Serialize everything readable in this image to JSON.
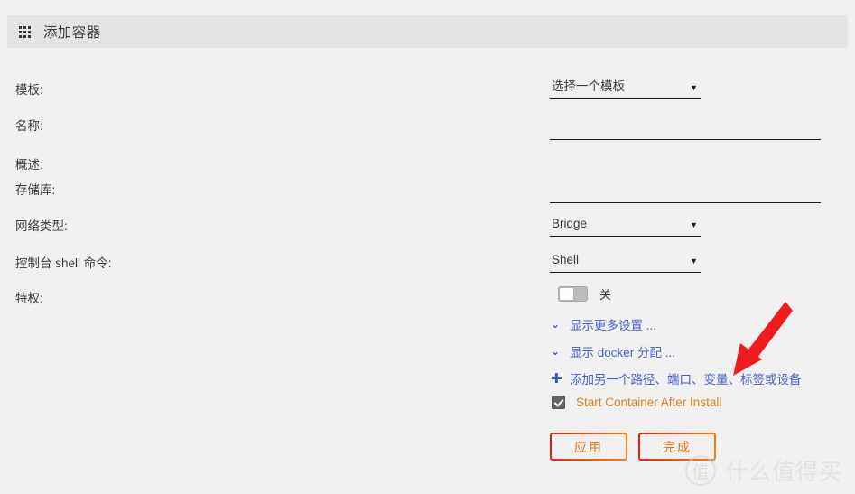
{
  "header": {
    "icon": "grid-icon",
    "title": "添加容器"
  },
  "form": {
    "rows": [
      {
        "label": "模板:",
        "control": "select",
        "value": "选择一个模板"
      },
      {
        "label": "名称:",
        "control": "input",
        "value": "",
        "placeholder": ""
      },
      {
        "label": "概述:",
        "control": "none",
        "value": ""
      },
      {
        "label": "存储库:",
        "control": "input",
        "value": "",
        "placeholder": ""
      },
      {
        "label": "网络类型:",
        "control": "select",
        "value": "Bridge"
      },
      {
        "label": "控制台 shell 命令:",
        "control": "select",
        "value": "Shell"
      },
      {
        "label": "特权:",
        "control": "toggle",
        "value": "关"
      }
    ],
    "caret_glyph": "▼"
  },
  "toggle": {
    "state": "off",
    "state_label": "关"
  },
  "links": [
    {
      "icon": "chevron-down-icon",
      "glyph": "⌄",
      "label": "显示更多设置 ..."
    },
    {
      "icon": "chevron-down-icon",
      "glyph": "⌄",
      "label": "显示 docker 分配 ..."
    },
    {
      "icon": "plus-icon",
      "glyph": "✚",
      "label": "添加另一个路径、端口、变量、标签或设备"
    }
  ],
  "checkbox": {
    "checked": true,
    "label": "Start Container After Install"
  },
  "buttons": [
    {
      "name": "apply-button",
      "label": "应用"
    },
    {
      "name": "done-button",
      "label": "完成"
    }
  ],
  "annotation": {
    "type": "arrow",
    "color": "#ee1c1c",
    "points_to": "添加另一个路径、端口、变量、标签或设备"
  },
  "watermark": {
    "logo_char": "值",
    "text": "什么值得买"
  },
  "colors": {
    "page_bg": "#f0f0f0",
    "titlebar_bg": "#e4e4e4",
    "link_blue": "#4a63c8",
    "accent_orange": "#e08020",
    "button_gradient_from": "#e11d14",
    "button_gradient_to": "#f5821f",
    "arrow_red": "#ee1c1c"
  }
}
